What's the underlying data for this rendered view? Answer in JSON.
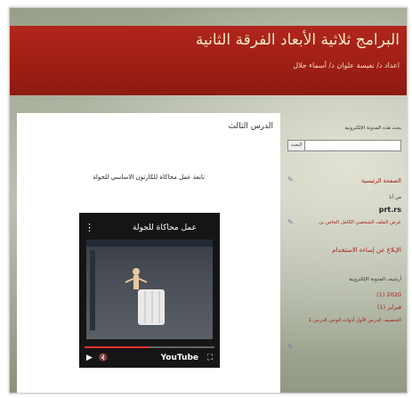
{
  "header": {
    "title": "البرامج ثلاثية الأبعاد الفرقة الثانية",
    "subtitle": "اعداد د/ نفيسة علوان د/ أسماء جلال"
  },
  "post": {
    "title": "الدرس الثالث",
    "text": "تابعة عمل محاكاة للكارتون الاساسي للجولة"
  },
  "video": {
    "title": "عمل محاكاة للجولة",
    "menu_icon": "⋮",
    "youtube_label": "YouTube",
    "fullscreen_icon": "⛶",
    "play_icon": "▶",
    "volume_icon": "🔇",
    "progress": 0.5
  },
  "sidebar": {
    "search_label": "بحث هذه المدونة الإلكترونية",
    "search_button": "البحث",
    "home": "الصفحة الرئيسية",
    "subscribe_label": "من أنا",
    "feed_label": "prt.rs",
    "feed_desc": "عرض الملف الشخصي الكامل الخاص بي",
    "report": "الإبلاغ عن إساءة الاستخدام",
    "archive_label": "أرشيف المدونة الإلكترونية",
    "year": "2020 (1)",
    "month": "فبراير (1)",
    "post_link": "التحصيف الدرس الأول أدوات الوحي الدرس 1"
  }
}
